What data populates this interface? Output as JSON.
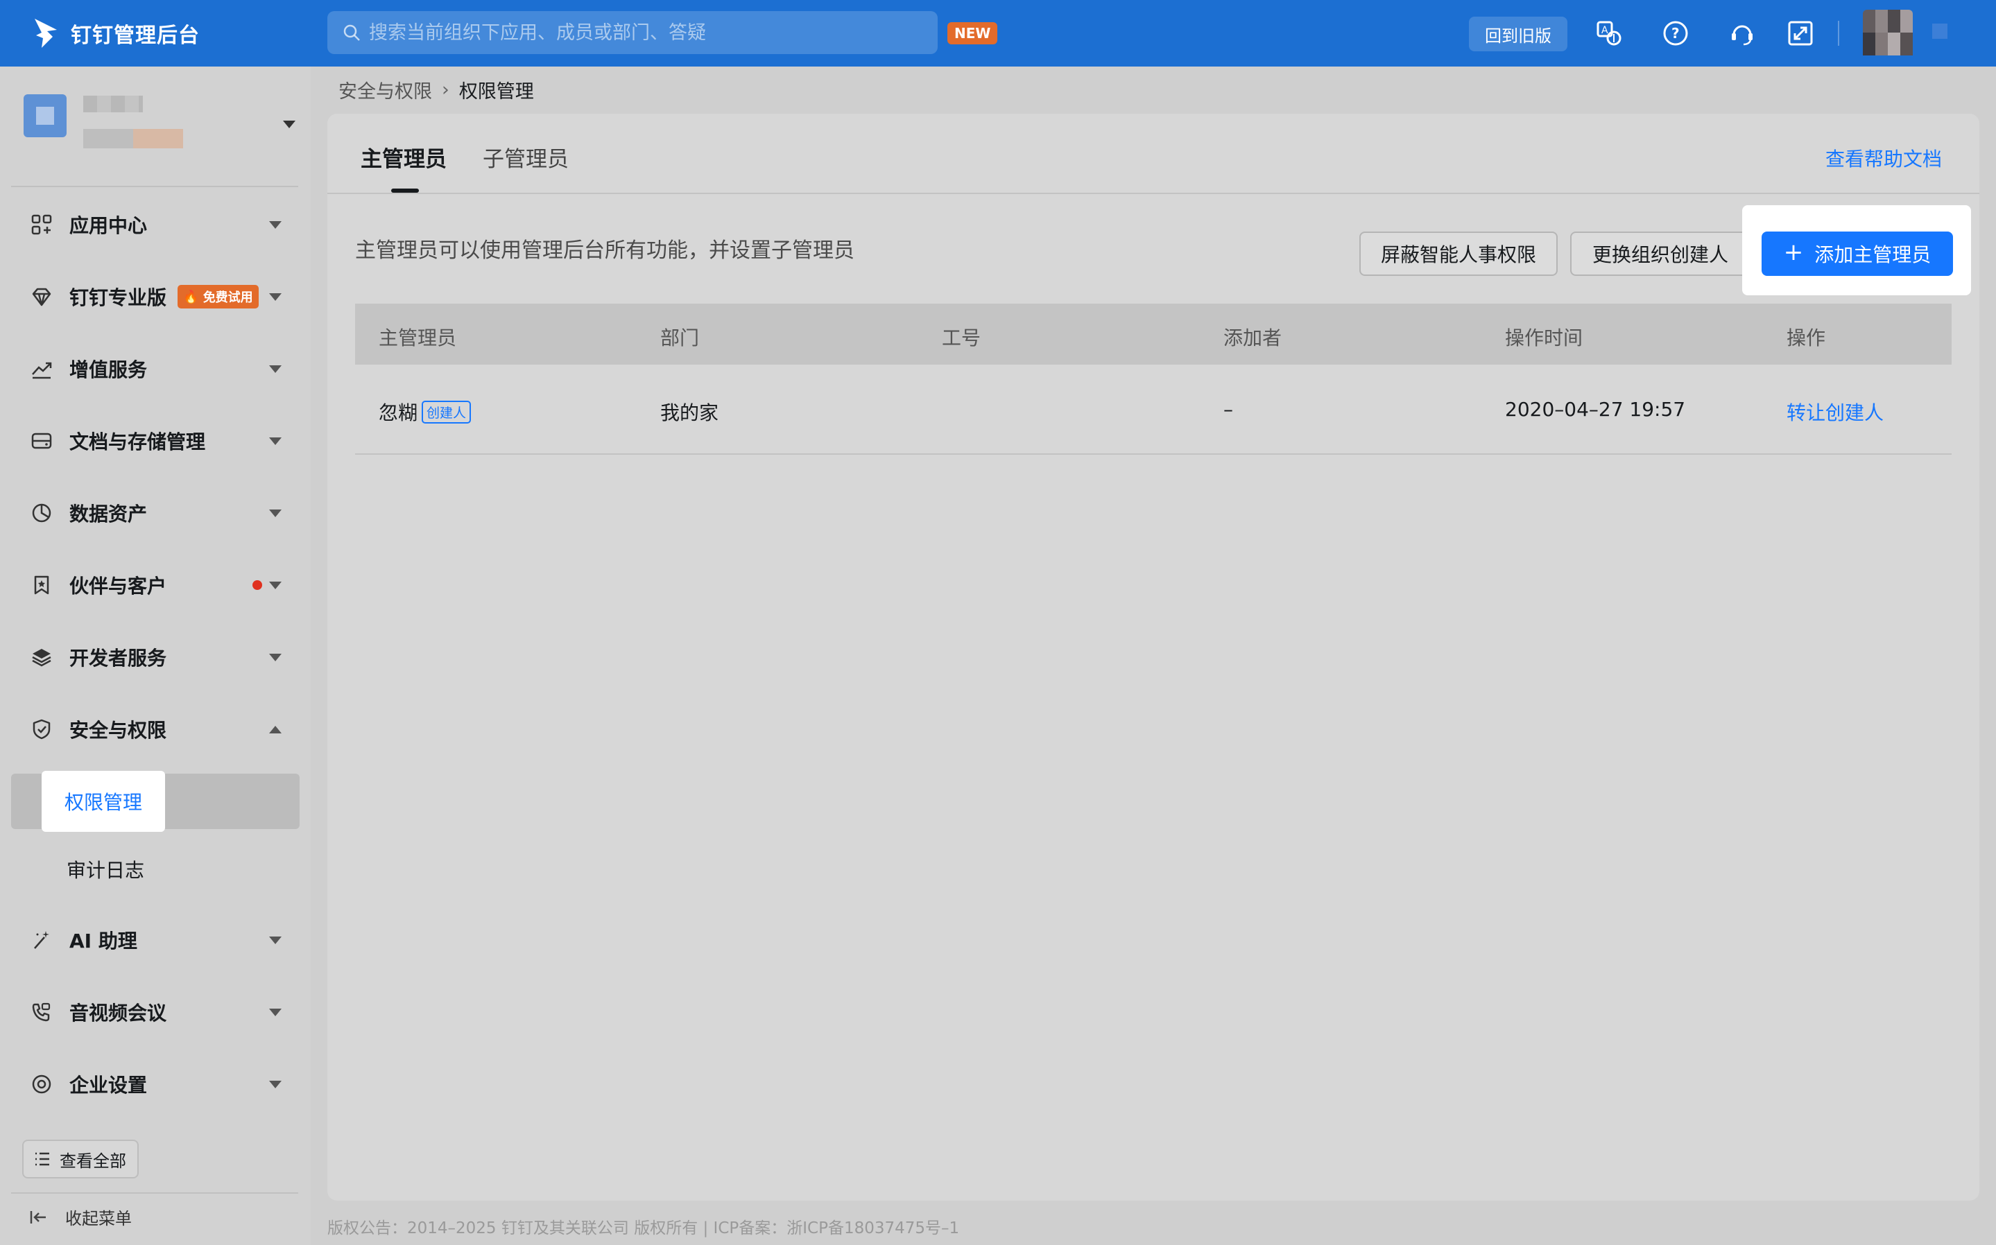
{
  "app": {
    "title": "钉钉管理后台",
    "search_placeholder": "搜索当前组织下应用、成员或部门、答疑",
    "new_badge": "NEW",
    "old_version_button": "回到旧版",
    "top_icons": [
      "translate-icon",
      "help-circle-icon",
      "headset-icon",
      "fullscreen-icon"
    ]
  },
  "sidebar": {
    "items": [
      {
        "label": "应用中心",
        "icon": "apps-grid-icon"
      },
      {
        "label": "钉钉专业版",
        "icon": "diamond-icon",
        "badge": "免费试用"
      },
      {
        "label": "增值服务",
        "icon": "trend-chart-icon"
      },
      {
        "label": "文档与存储管理",
        "icon": "storage-icon"
      },
      {
        "label": "数据资产",
        "icon": "pie-chart-icon"
      },
      {
        "label": "伙伴与客户",
        "icon": "bookmark-icon",
        "has_dot": true
      },
      {
        "label": "开发者服务",
        "icon": "layers-icon"
      },
      {
        "label": "安全与权限",
        "icon": "shield-icon",
        "expanded": true
      },
      {
        "label": "AI 助理",
        "icon": "magic-wand-icon"
      },
      {
        "label": "音视频会议",
        "icon": "phone-video-icon"
      },
      {
        "label": "企业设置",
        "icon": "settings-icon"
      }
    ],
    "sub_items": [
      "权限管理",
      "审计日志"
    ],
    "view_all": "查看全部",
    "collapse": "收起菜单"
  },
  "breadcrumb": {
    "parent": "安全与权限",
    "current": "权限管理"
  },
  "tabs": [
    "主管理员",
    "子管理员"
  ],
  "help_link": "查看帮助文档",
  "description": "主管理员可以使用管理后台所有功能，并设置子管理员",
  "buttons": {
    "block_hr": "屏蔽智能人事权限",
    "change_creator": "更换组织创建人",
    "add_admin": "添加主管理员"
  },
  "table": {
    "headers": [
      "主管理员",
      "部门",
      "工号",
      "添加者",
      "操作时间",
      "操作"
    ],
    "rows": [
      {
        "name": "忽糊",
        "tag": "创建人",
        "dept": "我的家",
        "emp_id": "",
        "added_by": "–",
        "time": "2020–04–27 19:57",
        "action": "转让创建人"
      }
    ]
  },
  "footer": "版权公告：2014–2025 钉钉及其关联公司 版权所有 | ICP备案：浙ICP备18037475号–1",
  "colors": {
    "topbar": "#1c6fd2",
    "accent": "#1677ff",
    "badge": "#e36b2a"
  }
}
